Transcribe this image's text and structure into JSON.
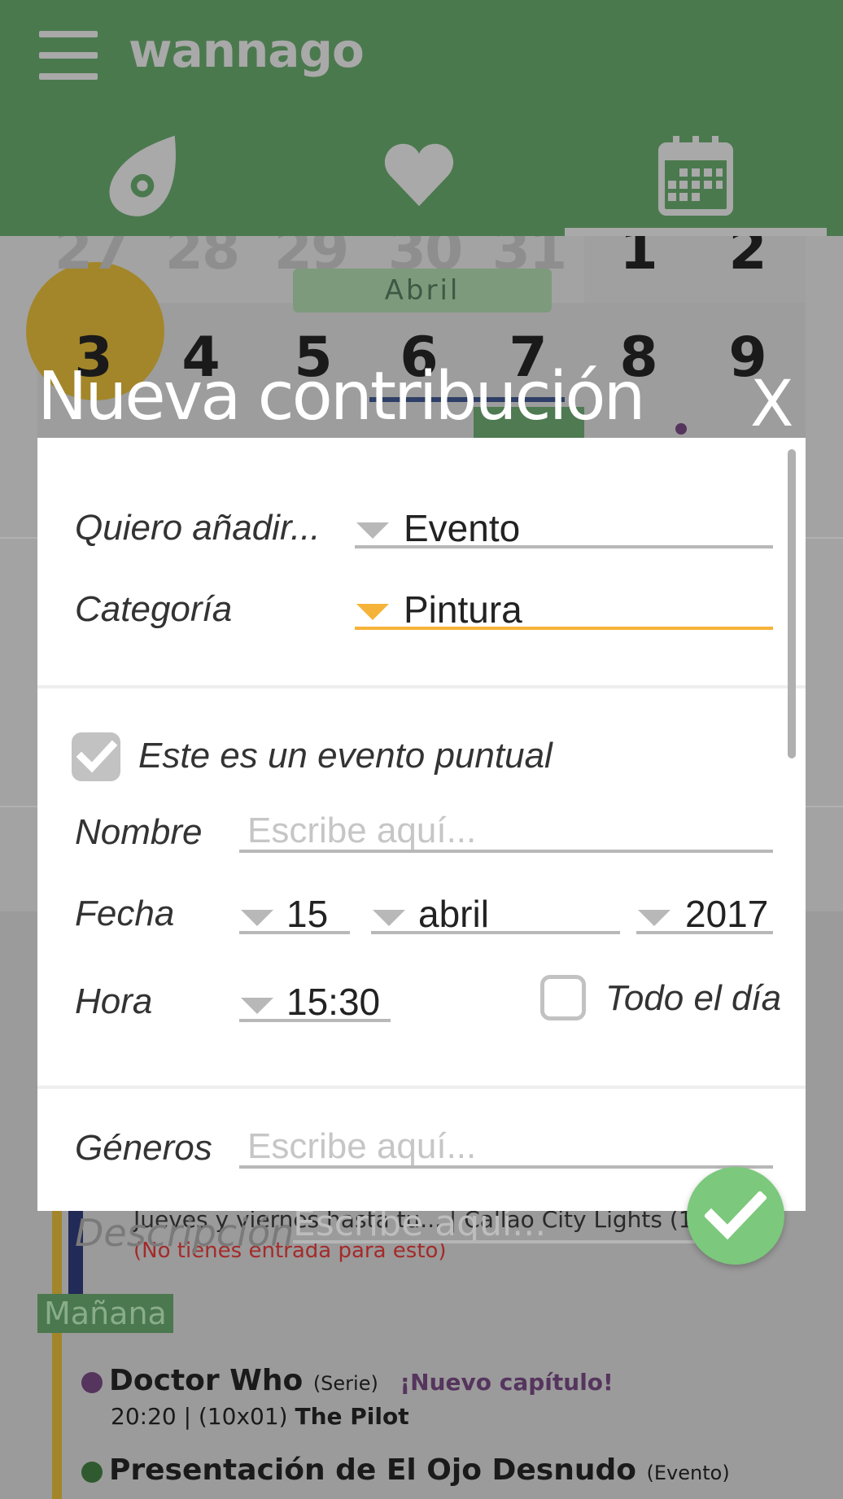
{
  "app": {
    "logo": "wannago"
  },
  "header": {
    "tabs": [
      {
        "name": "explore",
        "icon": "eye-flame-icon"
      },
      {
        "name": "favorites",
        "icon": "heart-icon"
      },
      {
        "name": "calendar",
        "icon": "calendar-icon",
        "active": true
      }
    ]
  },
  "calendar_bg": {
    "week1": [
      "27",
      "28",
      "29",
      "30",
      "31",
      "1",
      "2"
    ],
    "week2": [
      "3",
      "4",
      "5",
      "6",
      "7",
      "8",
      "9"
    ],
    "month": "Abril"
  },
  "events_bg": {
    "line1": "Jueves y viernes hasta tu... | Callao City Lights (1 k",
    "warning": "(No tienes entrada para esto)",
    "descripcion_label": "Descripción",
    "descripcion_placeholder": "Escribe aquí...",
    "section": "Mañana",
    "event1": {
      "title": "Doctor Who",
      "type": "(Serie)",
      "badge": "¡Nuevo capítulo!",
      "detail_time": "20:20 | (10x01) ",
      "detail_title": "The Pilot"
    },
    "event2": {
      "title": "Presentación de El Ojo Desnudo",
      "type": "(Evento)"
    }
  },
  "dialog": {
    "title": "Nueva contribución",
    "close": "X",
    "tipo": {
      "label": "Quiero añadir...",
      "value": "Evento"
    },
    "categoria": {
      "label": "Categoría",
      "value": "Pintura"
    },
    "puntual": {
      "label": "Este es un evento puntual",
      "checked": true
    },
    "nombre": {
      "label": "Nombre",
      "placeholder": "Escribe aquí...",
      "value": ""
    },
    "fecha": {
      "label": "Fecha",
      "day": "15",
      "month": "abril",
      "year": "2017"
    },
    "hora": {
      "label": "Hora",
      "value": "15:30"
    },
    "todo_el_dia": {
      "label": "Todo el día",
      "checked": false
    },
    "generos": {
      "label": "Géneros",
      "placeholder": "Escribe aquí..."
    }
  },
  "colors": {
    "header_green": "#4b794e",
    "accent_orange": "#f5b33a",
    "fab_green": "#7cc87c"
  }
}
